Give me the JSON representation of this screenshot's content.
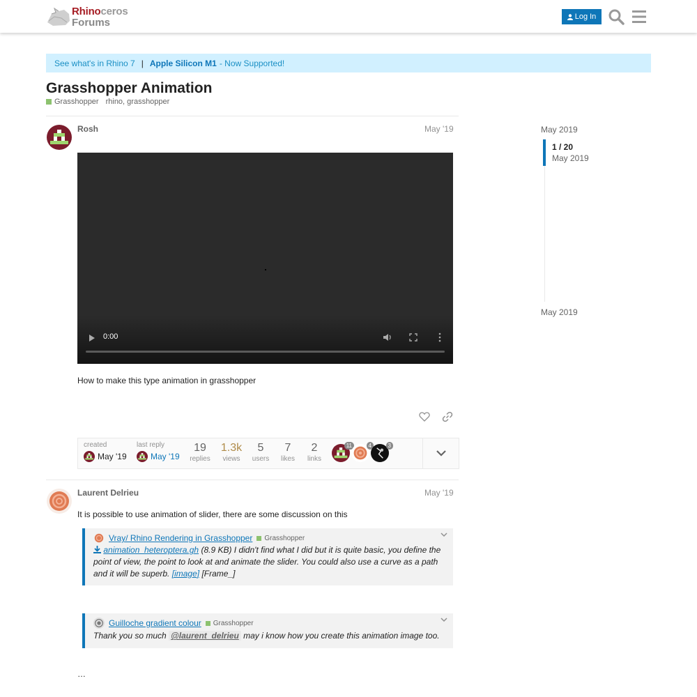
{
  "header": {
    "brand_line1_red": "Rhino",
    "brand_line1_rest": "ceros",
    "brand_line2": "Forums",
    "login_label": "Log In",
    "icons": [
      "user-icon",
      "search-icon",
      "hamburger-menu-icon"
    ]
  },
  "banner": {
    "link1": "See what's in Rhino 7",
    "separator": "|",
    "link2_bold": "Apple Silicon M1",
    "link2_rest": "- Now Supported!"
  },
  "topic": {
    "title": "Grasshopper Animation",
    "category": "Grasshopper",
    "tags": "rhino, grasshopper",
    "category_color": "#8dc26f"
  },
  "post1": {
    "username": "Rosh",
    "date": "May '19",
    "video_time": "0:00",
    "text": "How to make this type animation in grasshopper"
  },
  "topic_map": {
    "created_label": "created",
    "created_date": "May '19",
    "last_reply_label": "last reply",
    "last_reply_date": "May '19",
    "stats": [
      {
        "num": "19",
        "label": "replies"
      },
      {
        "num": "1.3k",
        "label": "views"
      },
      {
        "num": "5",
        "label": "users"
      },
      {
        "num": "7",
        "label": "likes"
      },
      {
        "num": "2",
        "label": "links"
      }
    ],
    "participant_counts": [
      "11",
      "4",
      "3"
    ]
  },
  "post2": {
    "username": "Laurent Delrieu",
    "date": "May '19",
    "text": "It is possible to use animation of slider, there are some discussion on this",
    "quote1": {
      "title": "Vray/ Rhino Rendering in Grasshopper",
      "category": "Grasshopper",
      "attachment": "animation_heteroptera.gh",
      "body_a": "(8.9 KB) I didn't find what I did but it is quite basic, you define the point of view, the point to look at and animate the slider. You could also use a curve as a path and it will be superb.",
      "image_link": "[image]",
      "body_b": "[Frame_]"
    },
    "quote2": {
      "title": "Guilloche gradient colour",
      "category": "Grasshopper",
      "body_a": "Thank you so much",
      "mention": "@laurent_delrieu",
      "body_b": "may i know how you create this animation image too."
    },
    "ellipsis": "…"
  },
  "timeline": {
    "top_date": "May 2019",
    "position": "1 / 20",
    "current_date": "May 2019",
    "bottom_date": "May 2019"
  },
  "colors": {
    "accent": "#0e76b8",
    "banner_bg": "#d1f0ff",
    "brand_red": "#a61d24"
  }
}
